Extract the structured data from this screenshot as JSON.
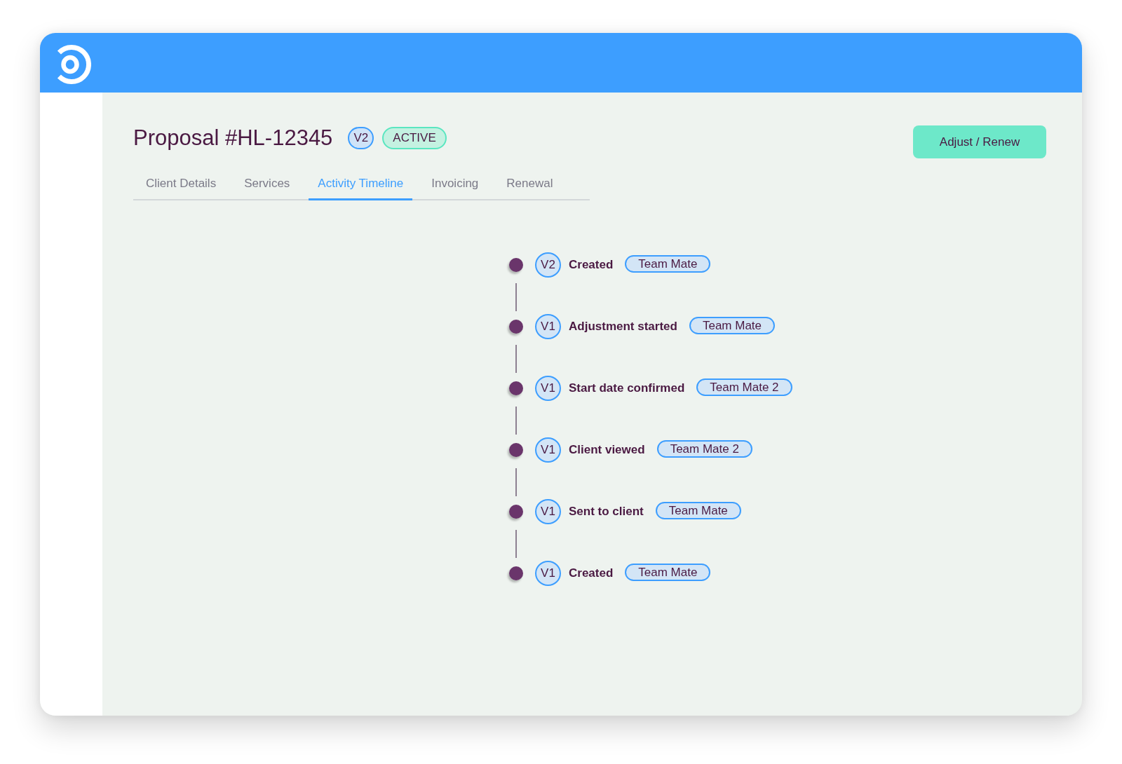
{
  "proposal": {
    "title": "Proposal #HL-12345",
    "version": "V2",
    "status": "ACTIVE",
    "action_button": "Adjust / Renew"
  },
  "tabs": [
    {
      "label": "Client Details",
      "selected": false
    },
    {
      "label": "Services",
      "selected": false
    },
    {
      "label": "Activity Timeline",
      "selected": true
    },
    {
      "label": "Invoicing",
      "selected": false
    },
    {
      "label": "Renewal",
      "selected": false
    }
  ],
  "timeline": [
    {
      "version": "V2",
      "event": "Created",
      "user": "Team Mate"
    },
    {
      "version": "V1",
      "event": "Adjustment started",
      "user": "Team Mate"
    },
    {
      "version": "V1",
      "event": "Start date confirmed",
      "user": "Team Mate 2"
    },
    {
      "version": "V1",
      "event": "Client viewed",
      "user": "Team Mate 2"
    },
    {
      "version": "V1",
      "event": "Sent to client",
      "user": "Team Mate"
    },
    {
      "version": "V1",
      "event": "Created",
      "user": "Team Mate"
    }
  ]
}
